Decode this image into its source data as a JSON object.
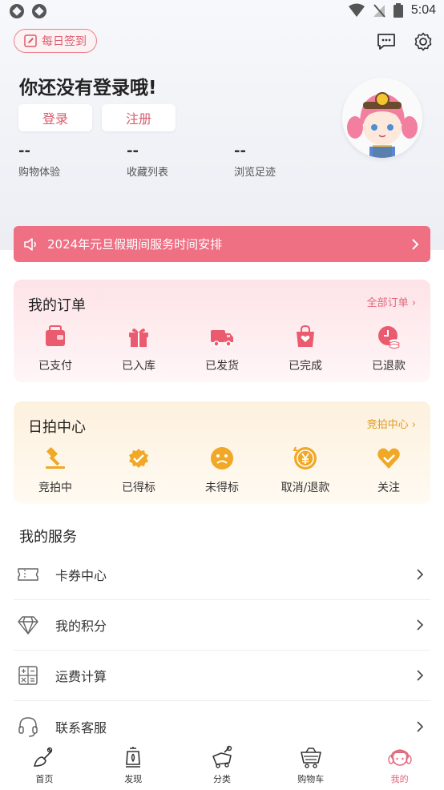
{
  "status_bar": {
    "time": "5:04"
  },
  "header": {
    "checkin_label": "每日签到",
    "headline": "你还没有登录哦!",
    "login_label": "登录",
    "register_label": "注册",
    "stats": [
      {
        "value": "--",
        "label": "购物体验"
      },
      {
        "value": "--",
        "label": "收藏列表"
      },
      {
        "value": "--",
        "label": "浏览足迹"
      }
    ]
  },
  "notice": {
    "text": "2024年元旦假期间服务时间安排"
  },
  "orders": {
    "title": "我的订单",
    "link": "全部订单 ›",
    "items": [
      {
        "label": "已支付",
        "icon": "wallet-icon"
      },
      {
        "label": "已入库",
        "icon": "gift-icon"
      },
      {
        "label": "已发货",
        "icon": "truck-icon"
      },
      {
        "label": "已完成",
        "icon": "bag-heart-icon"
      },
      {
        "label": "已退款",
        "icon": "refund-icon"
      }
    ]
  },
  "auction": {
    "title": "日拍中心",
    "link": "竞拍中心 ›",
    "items": [
      {
        "label": "竞拍中",
        "icon": "gavel-icon"
      },
      {
        "label": "已得标",
        "icon": "badge-check-icon"
      },
      {
        "label": "未得标",
        "icon": "sad-face-icon"
      },
      {
        "label": "取消/退款",
        "icon": "yen-coin-icon"
      },
      {
        "label": "关注",
        "icon": "heart-check-icon"
      }
    ]
  },
  "services": {
    "title": "我的服务",
    "items": [
      {
        "label": "卡券中心",
        "icon": "ticket-icon"
      },
      {
        "label": "我的积分",
        "icon": "diamond-icon"
      },
      {
        "label": "运费计算",
        "icon": "calculator-icon"
      },
      {
        "label": "联系客服",
        "icon": "headset-icon"
      }
    ]
  },
  "bottom_nav": {
    "items": [
      {
        "label": "首页",
        "icon": "shovel-home-icon"
      },
      {
        "label": "发现",
        "icon": "lantern-icon"
      },
      {
        "label": "分类",
        "icon": "minecart-icon"
      },
      {
        "label": "购物车",
        "icon": "cart-icon"
      },
      {
        "label": "我的",
        "icon": "avatar-girl-icon"
      }
    ]
  },
  "colors": {
    "brand_pink": "#ef6f83",
    "accent_red": "#d95c6d",
    "auction_gold": "#f0a826",
    "active_nav": "#e2687c"
  }
}
